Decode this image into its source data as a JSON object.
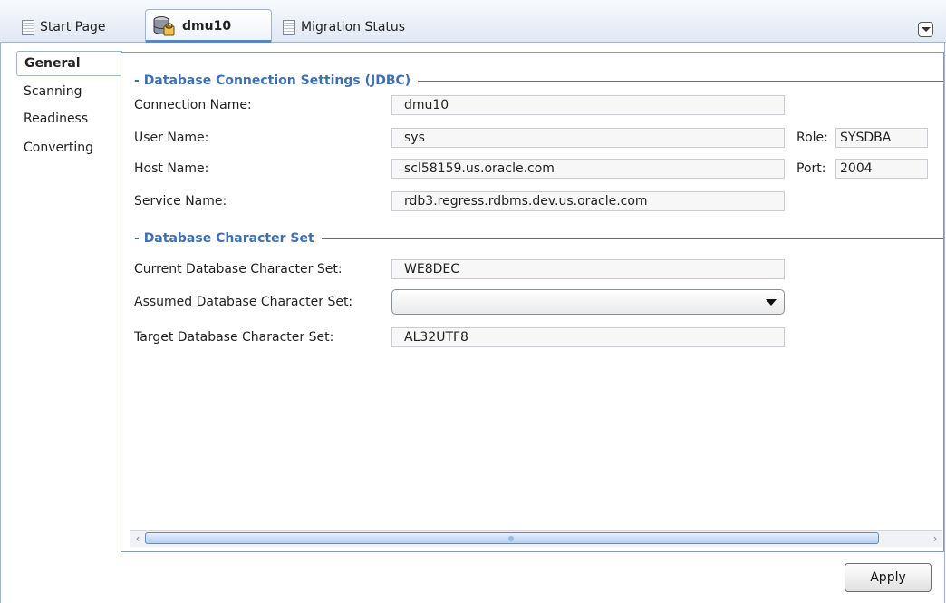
{
  "tabs": [
    {
      "label": "Start Page",
      "icon": "page-icon",
      "active": false
    },
    {
      "label": "dmu10",
      "icon": "database-icon",
      "active": true
    },
    {
      "label": "Migration Status",
      "icon": "page-icon",
      "active": false
    }
  ],
  "nav": {
    "items": [
      "General",
      "Scanning",
      "Readiness",
      "Converting"
    ],
    "selected": "General"
  },
  "jdbc_section": {
    "title": "Database Connection Settings (JDBC)",
    "connection_name_label": "Connection Name:",
    "connection_name_value": "dmu10",
    "user_name_label": "User Name:",
    "user_name_value": "sys",
    "role_label": "Role:",
    "role_value": "SYSDBA",
    "host_name_label": "Host Name:",
    "host_name_value": "scl58159.us.oracle.com",
    "port_label": "Port:",
    "port_value": "2004",
    "service_name_label": "Service Name:",
    "service_name_value": "rdb3.regress.rdbms.dev.us.oracle.com"
  },
  "charset_section": {
    "title": "Database Character Set",
    "current_label": "Current Database Character Set:",
    "current_value": "WE8DEC",
    "assumed_label": "Assumed Database Character Set:",
    "assumed_value": "",
    "target_label": "Target Database Character Set:",
    "target_value": "AL32UTF8"
  },
  "footer": {
    "apply_label": "Apply"
  },
  "colors": {
    "section_title": "#3e6fb3",
    "frame": "#9fb4cf",
    "field_background": "#f7f7f7"
  }
}
